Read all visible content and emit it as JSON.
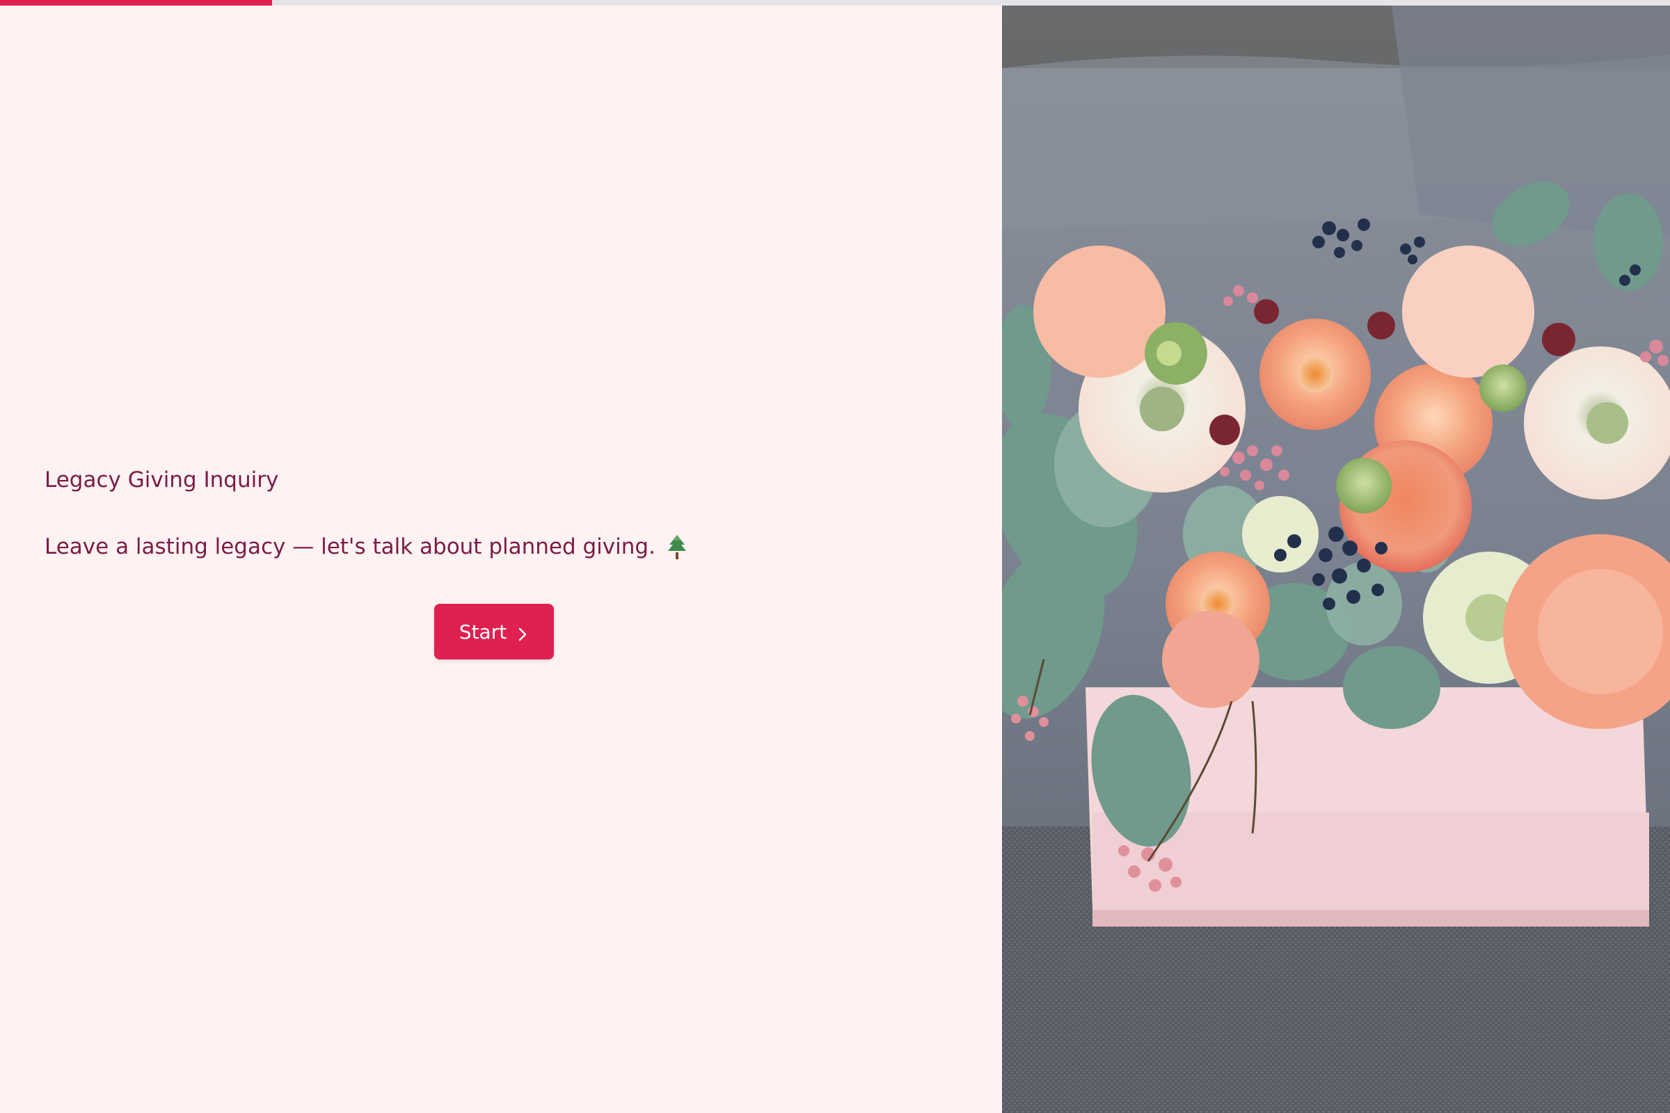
{
  "progress": {
    "fraction": 0.163,
    "fill_color": "#e0204f",
    "track_color": "#e6e3e8"
  },
  "form": {
    "title": "Legacy Giving Inquiry",
    "subtitle": "Leave a lasting legacy — let's talk about planned giving.",
    "subtitle_icon": "evergreen-tree-icon",
    "start_label": "Start",
    "start_icon": "chevron-right-icon"
  },
  "colors": {
    "background": "#fff2f3",
    "text": "#7a1c44",
    "accent": "#e0204f"
  },
  "hero_image": {
    "subject": "flower-bouquet-photo"
  }
}
